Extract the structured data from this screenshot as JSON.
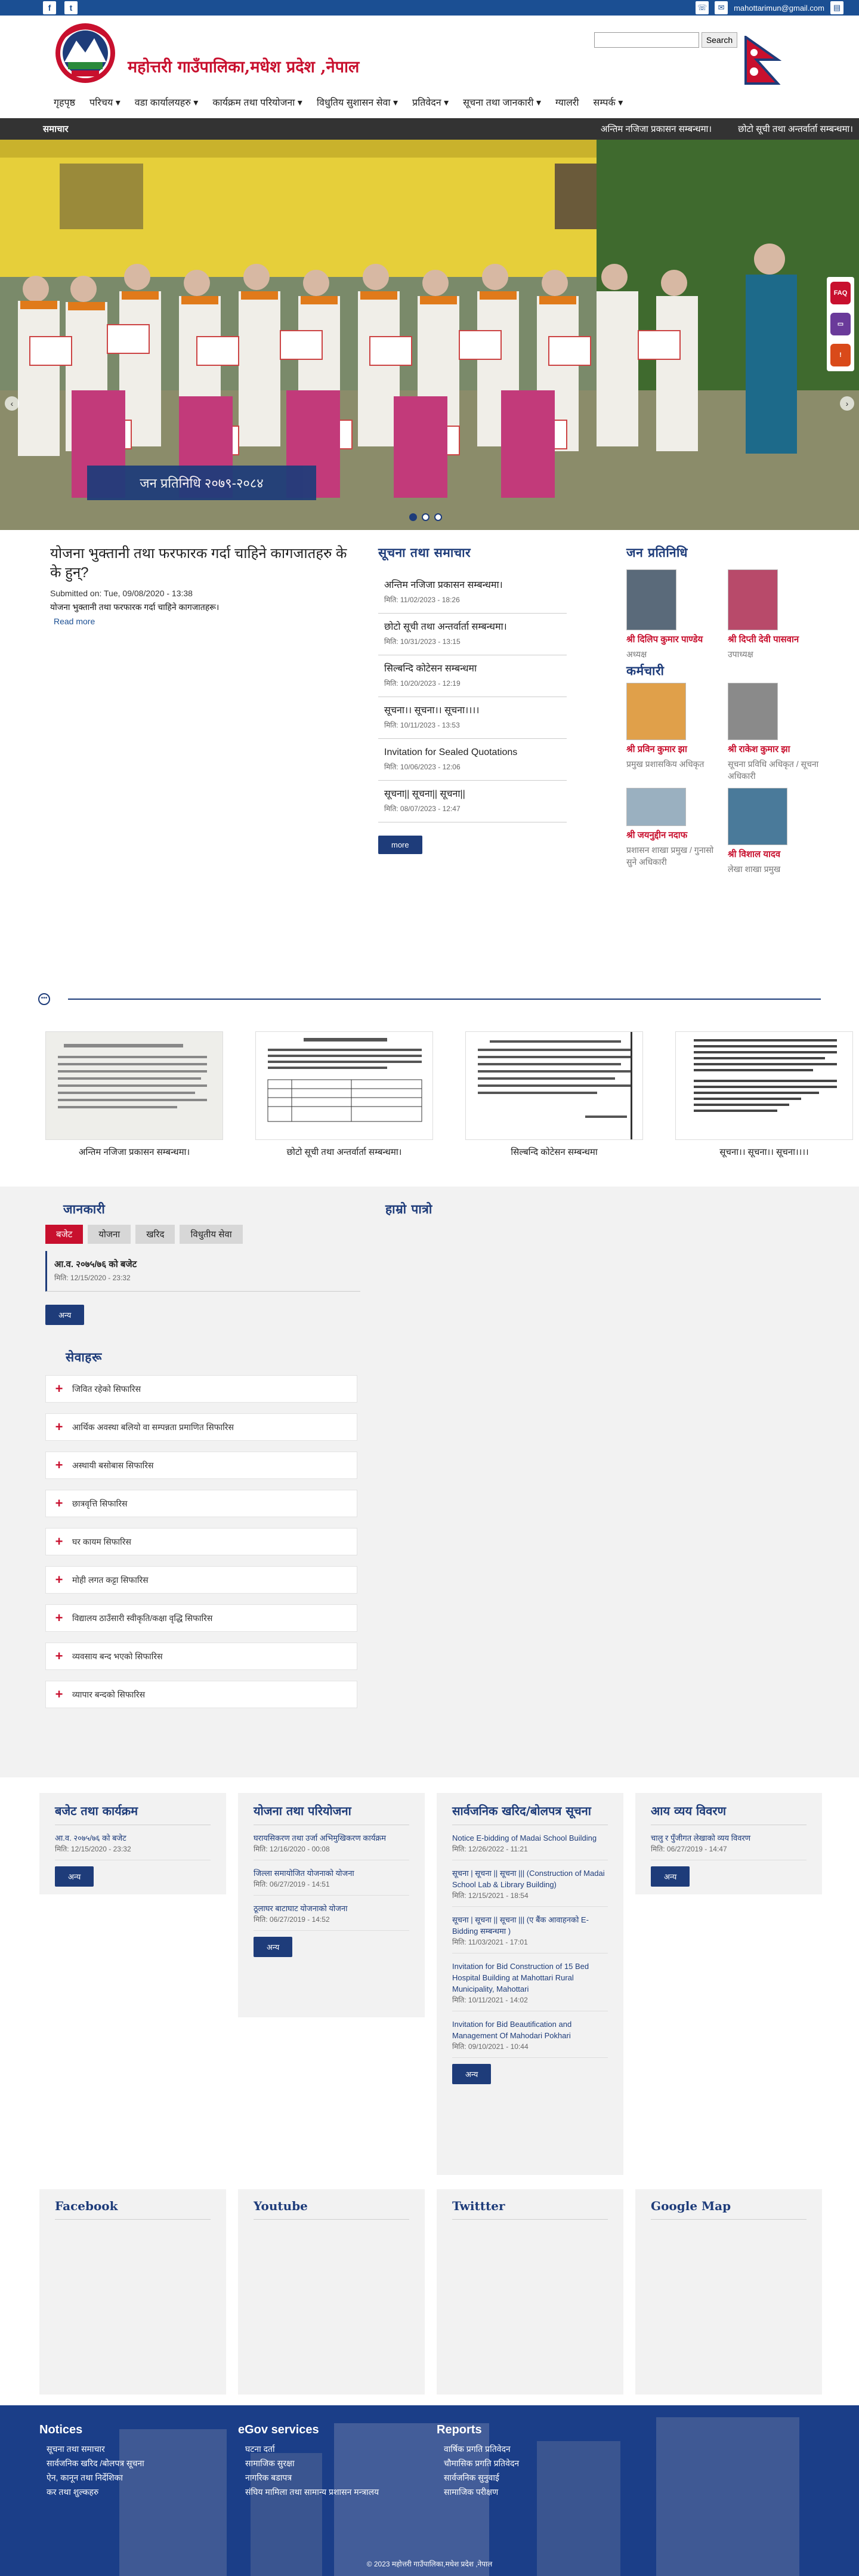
{
  "topbar": {
    "facebook": "f",
    "twitter": "t",
    "email": "mahottarimun@gmail.com"
  },
  "header": {
    "title": "महोत्तरी गाउँपालिका,मधेश प्रदेश ,नेपाल",
    "search_button": "Search",
    "search_placeholder": ""
  },
  "nav": [
    "गृहपृष्ठ",
    "परिचय ▾",
    "वडा कार्यालयहरु ▾",
    "कार्यक्रम तथा परियोजना ▾",
    "विधुतिय सुशासन सेवा ▾",
    "प्रतिवेदन ▾",
    "सूचना तथा जानकारी ▾",
    "ग्यालरी",
    "सम्पर्क ▾"
  ],
  "ticker": {
    "label": "समाचार",
    "items": [
      "अन्तिम नजिजा प्रकासन सम्बन्धमा।",
      "छोटो सूची तथा अन्तर्वार्ता सम्बन्धमा।"
    ]
  },
  "slider": {
    "caption": "जन प्रतिनिधि २०७९-२०८४"
  },
  "main_article": {
    "title": "योजना भुक्तानी तथा फरफारक गर्दा चाहिने कागजातहरु के के हुन्?",
    "submitted": "Submitted on: Tue, 09/08/2020 - 13:38",
    "body": "योजना भुक्तानी तथा फरफारक गर्दा चाहिने कागजातहरू।",
    "read_more": "Read more"
  },
  "news": {
    "heading": "सूचना तथा समाचार",
    "items": [
      {
        "title": "अन्तिम नजिजा प्रकासन सम्बन्धमा।",
        "date": "मिति: 11/02/2023 - 18:26"
      },
      {
        "title": "छोटो सूची तथा अन्तर्वार्ता सम्बन्धमा।",
        "date": "मिति: 10/31/2023 - 13:15"
      },
      {
        "title": "सिल्बन्दि कोटेसन सम्बन्धमा",
        "date": "मिति: 10/20/2023 - 12:19"
      },
      {
        "title": "सूचना।। सूचना।। सूचना।।।।",
        "date": "मिति: 10/11/2023 - 13:53"
      },
      {
        "title": "Invitation for Sealed Quotations",
        "date": "मिति: 10/06/2023 - 12:06"
      },
      {
        "title": "सूचना|| सूचना|| सूचना||",
        "date": "मिति: 08/07/2023 - 12:47"
      }
    ],
    "more": "more"
  },
  "representatives": {
    "heading": "जन प्रतिनिधि",
    "people": [
      {
        "name": "श्री दिलिप कुमार पाण्डेय",
        "role": "अध्यक्ष"
      },
      {
        "name": "श्री दिप्ती देवी पासवान",
        "role": "उपाध्यक्ष"
      }
    ]
  },
  "staff": {
    "heading": "कर्मचारी",
    "people": [
      {
        "name": "श्री प्रविन कुमार झा",
        "role": "प्रमुख प्रशासकिय अधिकृत"
      },
      {
        "name": "श्री राकेश कुमार झा",
        "role": "सूचना प्रविधि अधिकृत / सूचना अधिकारी"
      },
      {
        "name": "श्री जयनुद्दीन नदाफ",
        "role": "प्रशासन शाखा प्रमुख / गुनासो सुने अधिकारी"
      },
      {
        "name": "श्री विशाल यादव",
        "role": "लेखा शाखा प्रमुख"
      }
    ]
  },
  "gallery": [
    "अन्तिम नजिजा प्रकासन सम्बन्धमा।",
    "छोटो सूची तथा अन्तर्वार्ता सम्बन्धमा।",
    "सिल्बन्दि कोटेसन सम्बन्धमा",
    "सूचना।। सूचना।। सूचना।।।।"
  ],
  "janakari": {
    "heading": "जानकारी",
    "tabs": [
      "बजेट",
      "योजना",
      "खरिद",
      "विधुतीय सेवा"
    ],
    "budget_item": {
      "title": "आ.व. २०७५/७६ को बजेट",
      "date": "मिति: 12/15/2020 - 23:32"
    },
    "more": "अन्य"
  },
  "hamro_patro": "हाम्रो पात्रो",
  "sewa": {
    "heading": "सेवाहरू",
    "items": [
      "जिवित रहेको सिफारिस",
      "आर्थिक अवस्था बलियो वा सम्पन्नता प्रमाणित सिफारिस",
      "अस्थायी बसोबास सिफारिस",
      "छात्रवृत्ति सिफारिस",
      "घर कायम सिफारिस",
      "मोही लगत कट्टा सिफारिस",
      "विद्यालय ठाउँसारी स्वीकृति/कक्षा वृद्धि सिफारिस",
      "व्यवसाय बन्द भएको सिफारिस",
      "व्यापार बन्दको सिफारिस"
    ]
  },
  "cards": [
    {
      "heading": "बजेट तथा कार्यक्रम",
      "items": [
        {
          "title": "आ.व. २०७५/७६ को बजेट",
          "date": "मिति: 12/15/2020 - 23:32"
        }
      ],
      "more": "अन्य"
    },
    {
      "heading": "योजना तथा परियोजना",
      "items": [
        {
          "title": "घरायसिकरण तथा उर्जा अभिमुखिकरण कार्यक्रम",
          "date": "मिति: 12/16/2020 - 00:08"
        },
        {
          "title": "जिल्ला समायोजित योजनाको योजना",
          "date": "मिति: 06/27/2019 - 14:51"
        },
        {
          "title": "ठूलाघर बाटाघाट योजनाको योजना",
          "date": "मिति: 06/27/2019 - 14:52"
        }
      ],
      "more": "अन्य"
    },
    {
      "heading": "सार्वजनिक खरिद/बोलपत्र सूचना",
      "items": [
        {
          "title": "Notice E-bidding of Madai School Building",
          "date": "मिति: 12/26/2022 - 11:21"
        },
        {
          "title": "सूचना | सूचना || सूचना ||| (Construction of Madai School Lab & Library Building)",
          "date": "मिति: 12/15/2021 - 18:54"
        },
        {
          "title": "सूचना | सूचना || सूचना ||| (ए बैंक आवाहनको E-Bidding सम्बन्धमा )",
          "date": "मिति: 11/03/2021 - 17:01"
        },
        {
          "title": "Invitation for Bid Construction of 15 Bed Hospital Building at Mahottari Rural Municipality, Mahottari",
          "date": "मिति: 10/11/2021 - 14:02"
        },
        {
          "title": "Invitation for Bid Beautification and Management Of Mahodari Pokhari",
          "date": "मिति: 09/10/2021 - 10:44"
        }
      ],
      "more": "अन्य"
    },
    {
      "heading": "आय व्यय विवरण",
      "items": [
        {
          "title": "चालु र पुँजीगत लेखाको व्यय विवरण",
          "date": "मिति: 06/27/2019 - 14:47"
        }
      ],
      "more": "अन्य"
    }
  ],
  "social": [
    "Facebook",
    "Youtube",
    "Twittter",
    "Google Map"
  ],
  "footer": {
    "cols": [
      {
        "heading": "Notices",
        "items": [
          "सूचना तथा समाचार",
          "सार्वजनिक खरिद /बोलपत्र सूचना",
          "ऐन, कानून तथा निर्देशिका",
          "कर तथा शुल्कहरु"
        ]
      },
      {
        "heading": "eGov services",
        "items": [
          "घटना दर्ता",
          "सामाजिक सुरक्षा",
          "नागरिक बडापत्र",
          "संघिय मामिला तथा सामान्य प्रशासन मन्त्रालय"
        ]
      },
      {
        "heading": "Reports",
        "items": [
          "वार्षिक प्रगति प्रतिवेदन",
          "चौमासिक प्रगति प्रतिवेदन",
          "सार्वजनिक सुनुवाई",
          "सामाजिक परीक्षण"
        ]
      }
    ],
    "copyright": "© 2023 महोत्तरी गाउँपालिका,मधेश प्रदेश ,नेपाल"
  },
  "colors": {
    "brand_blue": "#1e3c7a",
    "brand_red": "#c8102e",
    "footer_blue": "#1b3e88"
  }
}
